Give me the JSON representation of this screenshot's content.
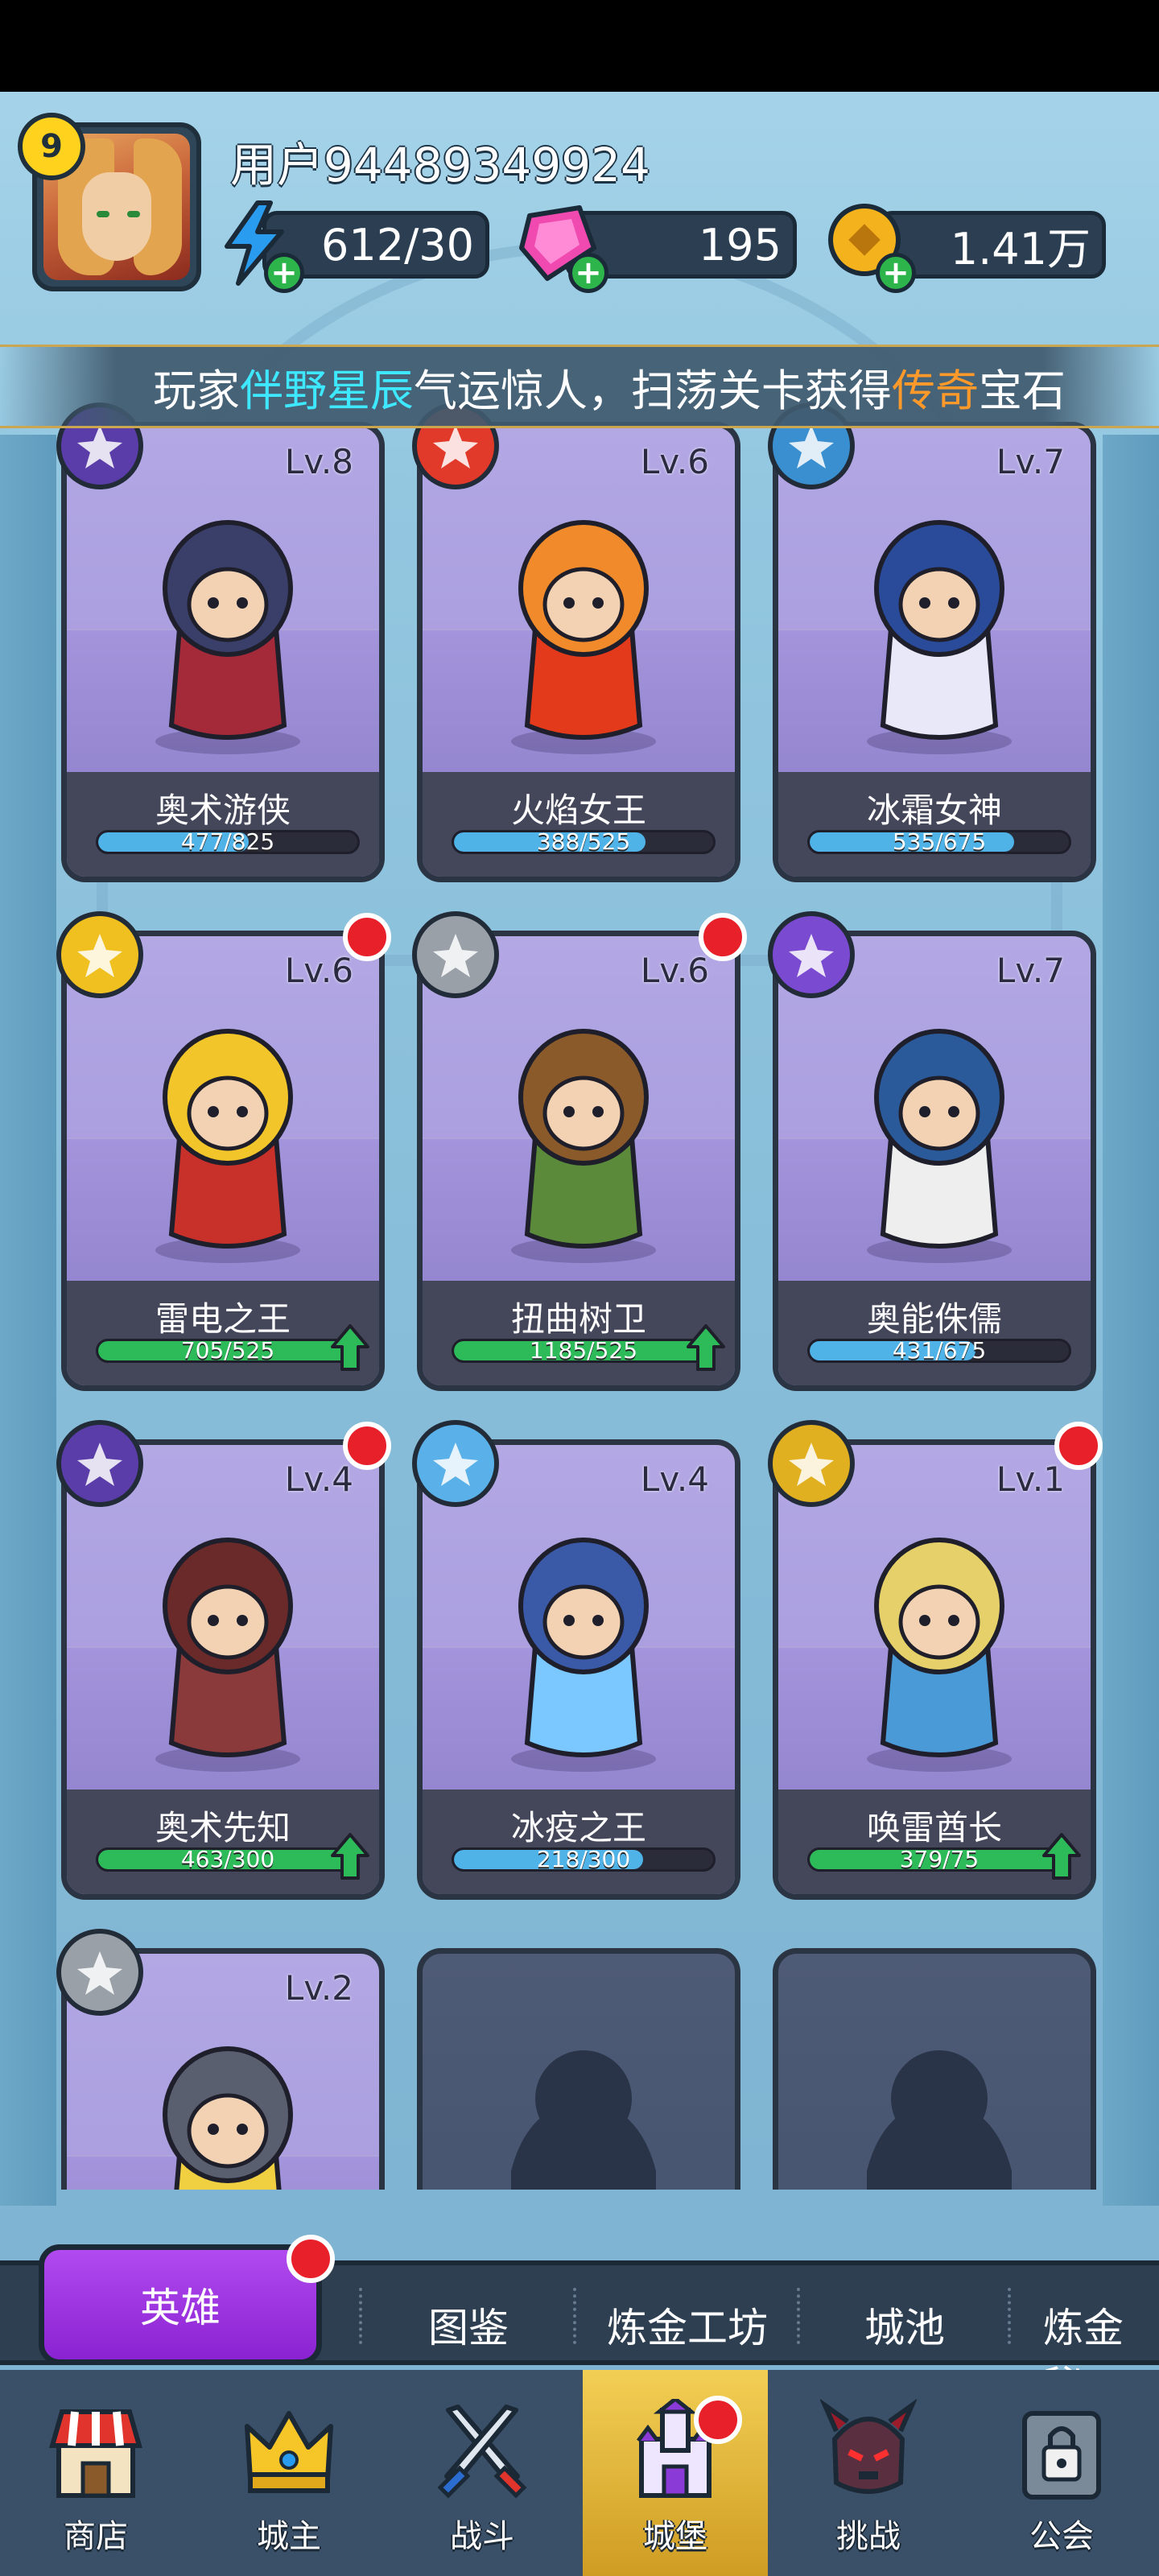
{
  "header": {
    "level": "9",
    "username": "用户94489349924",
    "energy": "612/30",
    "gems": "195",
    "gold": "1.41万"
  },
  "marquee": {
    "prefix": "玩家",
    "player": "伴野星辰",
    "middle": "气运惊人，扫荡关卡获得",
    "rarity": "传奇",
    "suffix": "宝石"
  },
  "heroes": [
    {
      "name": "奥术游侠",
      "level": "Lv.8",
      "progress": "477/825",
      "fill": 0.58,
      "bar_color": "#4fb3e8",
      "element": "arcane-arrows",
      "elem_color": "#5a3da8",
      "dot": false,
      "upgrade": false
    },
    {
      "name": "火焰女王",
      "level": "Lv.6",
      "progress": "388/525",
      "fill": 0.74,
      "bar_color": "#4fb3e8",
      "element": "fire",
      "elem_color": "#e23a2a",
      "dot": false,
      "upgrade": false
    },
    {
      "name": "冰霜女神",
      "level": "Lv.7",
      "progress": "535/675",
      "fill": 0.79,
      "bar_color": "#4fb3e8",
      "element": "ice",
      "elem_color": "#3a8fd0",
      "dot": false,
      "upgrade": false
    },
    {
      "name": "雷电之王",
      "level": "Lv.6",
      "progress": "705/525",
      "fill": 1.0,
      "bar_color": "#2dbb5a",
      "element": "lightning",
      "elem_color": "#f0c020",
      "dot": true,
      "upgrade": true
    },
    {
      "name": "扭曲树卫",
      "level": "Lv.6",
      "progress": "1185/525",
      "fill": 1.0,
      "bar_color": "#2dbb5a",
      "element": "armor",
      "elem_color": "#9aa0a8",
      "dot": true,
      "upgrade": true
    },
    {
      "name": "奥能侏儒",
      "level": "Lv.7",
      "progress": "431/675",
      "fill": 0.64,
      "bar_color": "#4fb3e8",
      "element": "arcane",
      "elem_color": "#7a4ad0",
      "dot": false,
      "upgrade": false
    },
    {
      "name": "奥术先知",
      "level": "Lv.4",
      "progress": "463/300",
      "fill": 1.0,
      "bar_color": "#2dbb5a",
      "element": "arcane-arrows",
      "elem_color": "#5a3da8",
      "dot": true,
      "upgrade": true
    },
    {
      "name": "冰疫之王",
      "level": "Lv.4",
      "progress": "218/300",
      "fill": 0.73,
      "bar_color": "#4fb3e8",
      "element": "ice-crystal",
      "elem_color": "#5ab0e8",
      "dot": false,
      "upgrade": false
    },
    {
      "name": "唤雷酋长",
      "level": "Lv.1",
      "progress": "379/75",
      "fill": 1.0,
      "bar_color": "#2dbb5a",
      "element": "thunder",
      "elem_color": "#e0b020",
      "dot": true,
      "upgrade": true
    },
    {
      "name": "",
      "level": "Lv.2",
      "progress": "",
      "fill": 0,
      "bar_color": "#4fb3e8",
      "element": "stone",
      "elem_color": "#9aa0a8",
      "dot": false,
      "upgrade": false
    }
  ],
  "subtabs": {
    "hero": "英雄",
    "codex": "图鉴",
    "workshop": "炼金工坊",
    "city": "城池",
    "secret": "炼金秘"
  },
  "nav": {
    "shop": "商店",
    "lord": "城主",
    "battle": "战斗",
    "castle": "城堡",
    "challenge": "挑战",
    "guild": "公会"
  },
  "colors": {
    "accent_purple": "#8a22d2",
    "nav_active": "#f2cf54",
    "highlight_cyan": "#3ee8ff",
    "highlight_orange": "#ff9a2a"
  }
}
